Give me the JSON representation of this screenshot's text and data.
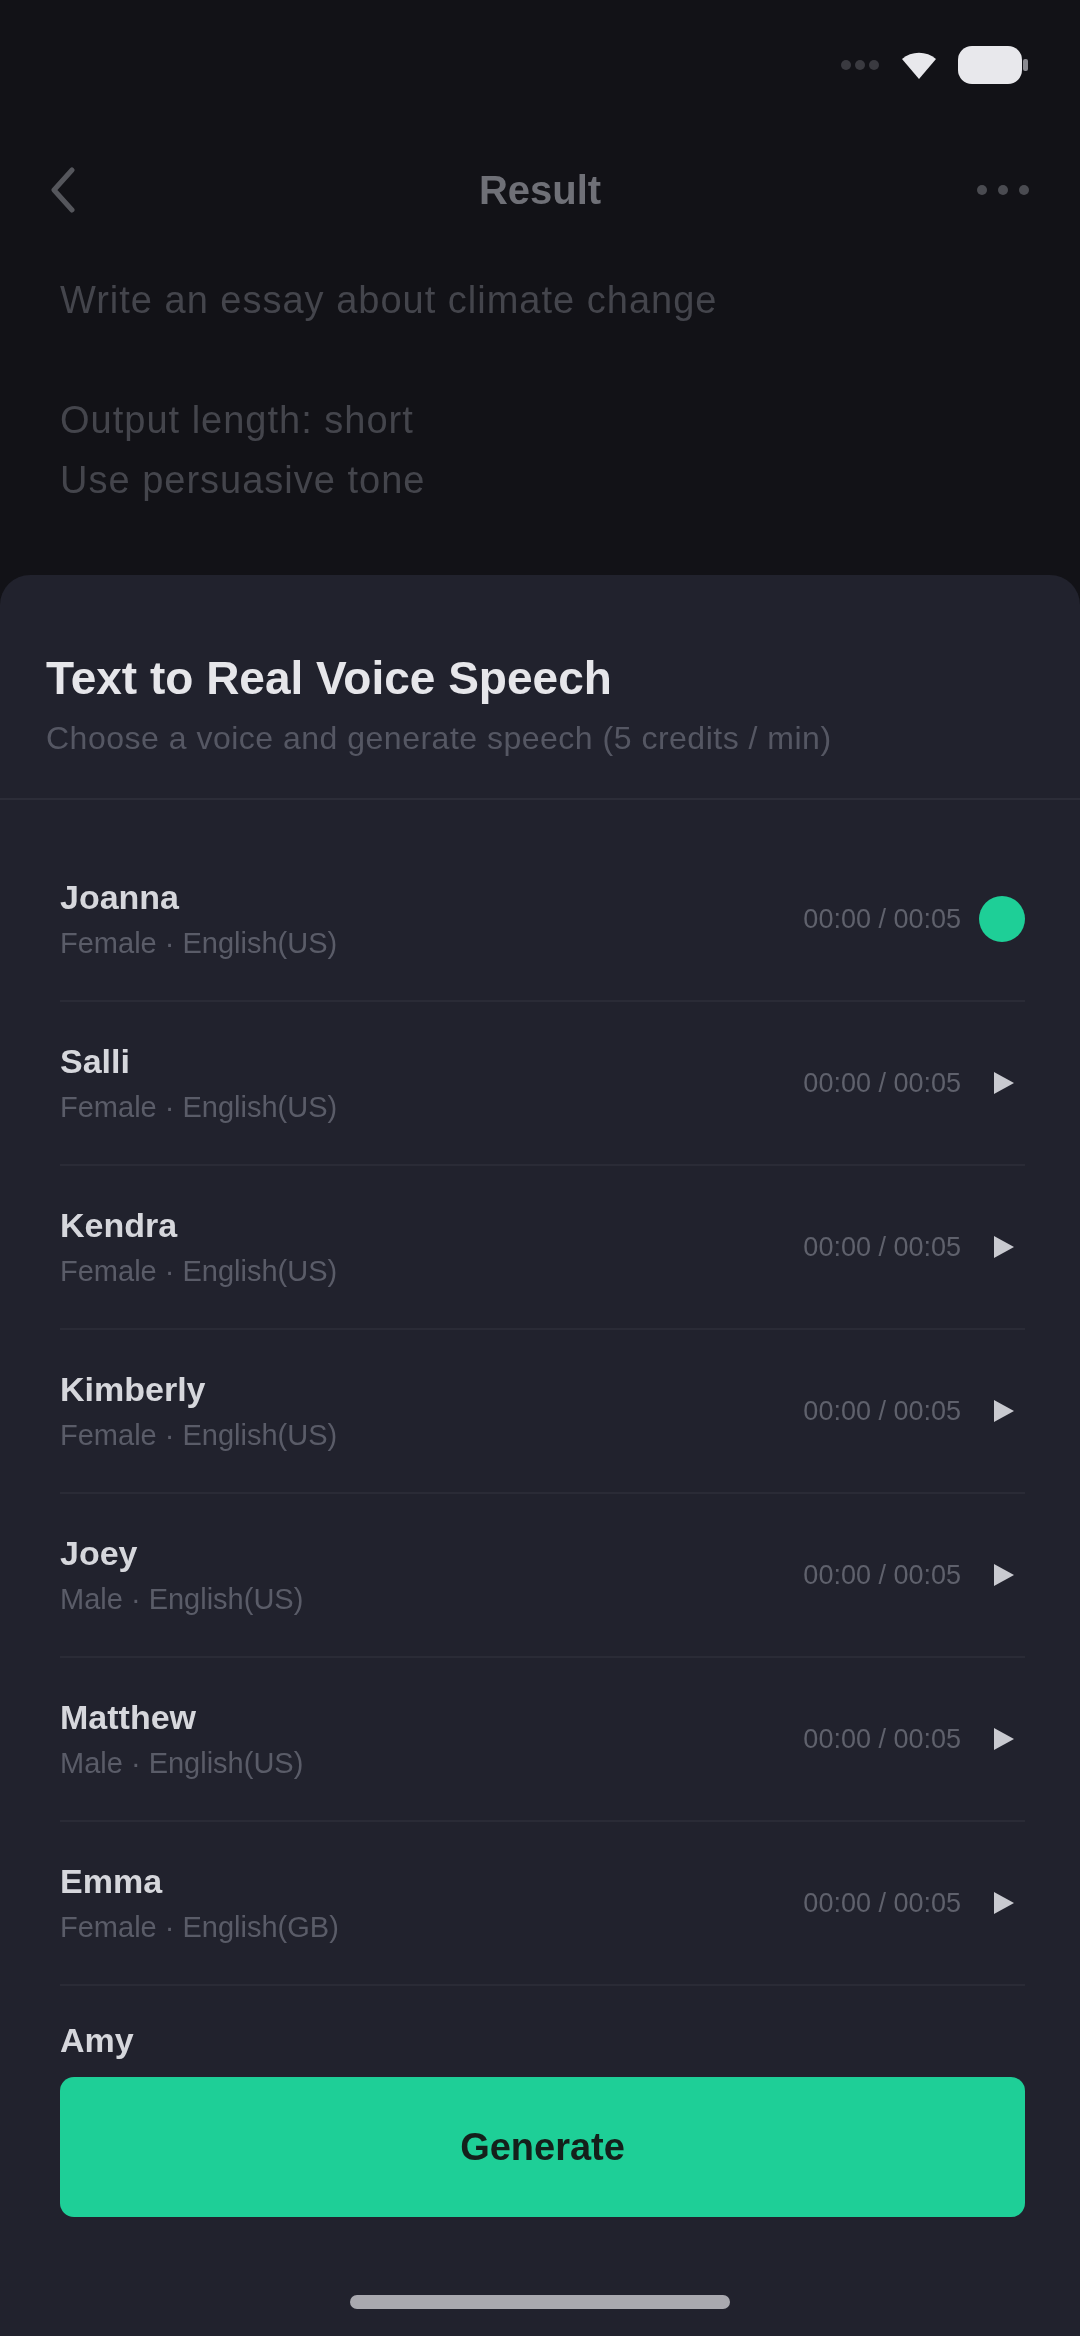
{
  "nav": {
    "title": "Result"
  },
  "prompt": {
    "text": "Write an essay about climate change",
    "options": [
      "Output length: short",
      "Use persuasive tone"
    ]
  },
  "sheet": {
    "title": "Text to Real Voice Speech",
    "subtitle": "Choose a voice and generate speech (5 credits / min)"
  },
  "voices": [
    {
      "kind": "full",
      "name": "Joanna",
      "details": "Female · English(US)",
      "time": "00:00 / 00:05",
      "selected": true
    },
    {
      "kind": "full",
      "name": "Salli",
      "details": "Female · English(US)",
      "time": "00:00 / 00:05",
      "selected": false
    },
    {
      "kind": "full",
      "name": "Kendra",
      "details": "Female · English(US)",
      "time": "00:00 / 00:05",
      "selected": false
    },
    {
      "kind": "full",
      "name": "Kimberly",
      "details": "Female · English(US)",
      "time": "00:00 / 00:05",
      "selected": false
    },
    {
      "kind": "full",
      "name": "Joey",
      "details": "Male · English(US)",
      "time": "00:00 / 00:05",
      "selected": false
    },
    {
      "kind": "full",
      "name": "Matthew",
      "details": "Male · English(US)",
      "time": "00:00 / 00:05",
      "selected": false
    },
    {
      "kind": "full",
      "name": "Emma",
      "details": "Female · English(GB)",
      "time": "00:00 / 00:05",
      "selected": false
    },
    {
      "kind": "partial",
      "name": "Amy"
    }
  ],
  "generate_button": "Generate"
}
